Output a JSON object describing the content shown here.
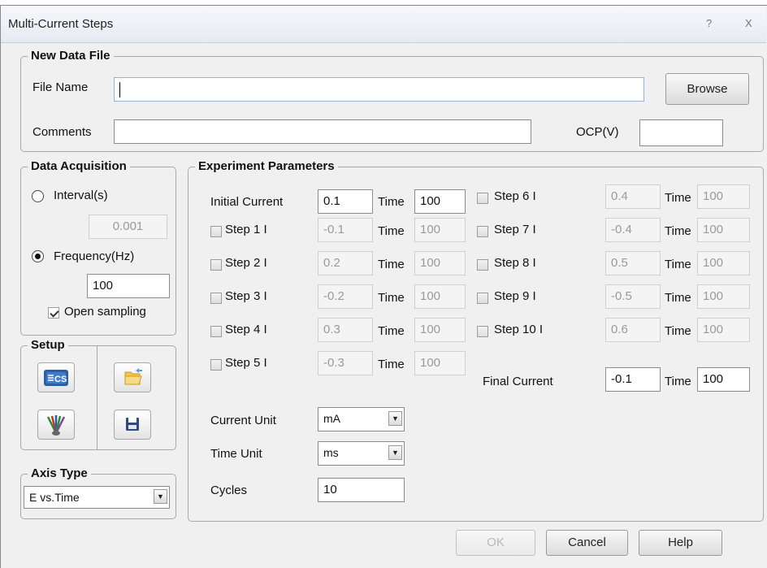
{
  "window": {
    "title": "Multi-Current Steps",
    "help_glyph": "?",
    "close_glyph": "X"
  },
  "new_data_file": {
    "legend": "New Data File",
    "file_name_label": "File Name",
    "file_name_value": "",
    "browse_label": "Browse",
    "comments_label": "Comments",
    "comments_value": "",
    "ocp_label": "OCP(V)",
    "ocp_value": ""
  },
  "data_acquisition": {
    "legend": "Data Acquisition",
    "interval_label": "Interval(s)",
    "interval_value": "0.001",
    "frequency_label": "Frequency(Hz)",
    "frequency_value": "100",
    "selected": "frequency",
    "open_sampling_label": "Open sampling",
    "open_sampling_checked": true
  },
  "setup": {
    "legend": "Setup",
    "buttons": [
      "cs-instrument-icon",
      "open-folder-icon",
      "electrode-fan-icon",
      "save-disk-icon"
    ]
  },
  "axis_type": {
    "legend": "Axis Type",
    "value": "E vs.Time"
  },
  "experiment": {
    "legend": "Experiment Parameters",
    "time_label": "Time",
    "initial_current_label": "Initial Current",
    "initial_current": "0.1",
    "initial_time": "100",
    "steps": [
      {
        "label": "Step 1 I",
        "current": "-0.1",
        "time": "100",
        "checked": false
      },
      {
        "label": "Step 2 I",
        "current": "0.2",
        "time": "100",
        "checked": false
      },
      {
        "label": "Step 3 I",
        "current": "-0.2",
        "time": "100",
        "checked": false
      },
      {
        "label": "Step 4 I",
        "current": "0.3",
        "time": "100",
        "checked": false
      },
      {
        "label": "Step 5 I",
        "current": "-0.3",
        "time": "100",
        "checked": false
      },
      {
        "label": "Step 6 I",
        "current": "0.4",
        "time": "100",
        "checked": false
      },
      {
        "label": "Step 7 I",
        "current": "-0.4",
        "time": "100",
        "checked": false
      },
      {
        "label": "Step 8 I",
        "current": "0.5",
        "time": "100",
        "checked": false
      },
      {
        "label": "Step 9 I",
        "current": "-0.5",
        "time": "100",
        "checked": false
      },
      {
        "label": "Step 10 I",
        "current": "0.6",
        "time": "100",
        "checked": false
      }
    ],
    "final_current_label": "Final Current",
    "final_current": "-0.1",
    "final_time": "100",
    "current_unit_label": "Current Unit",
    "current_unit": "mA",
    "time_unit_label": "Time Unit",
    "time_unit": "ms",
    "cycles_label": "Cycles",
    "cycles": "10"
  },
  "buttons": {
    "ok": "OK",
    "cancel": "Cancel",
    "help": "Help"
  },
  "colors": {
    "cs_icon": "#2a5fa8",
    "focus_border": "#8fb4d8"
  }
}
